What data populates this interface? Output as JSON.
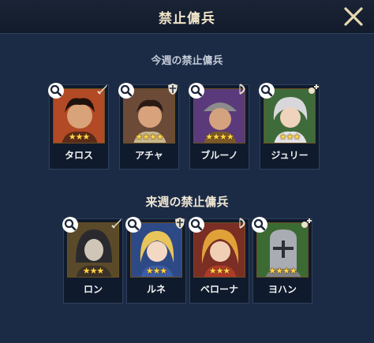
{
  "header": {
    "title": "禁止傭兵"
  },
  "this_week": {
    "title": "今週の禁止傭兵",
    "mercs": [
      {
        "name": "タロス",
        "stars": "★★★",
        "role_icon": "sword-icon",
        "bg": "#b34a26"
      },
      {
        "name": "アチャ",
        "stars": "★★★★",
        "role_icon": "shield-icon",
        "bg": "#6b4a38"
      },
      {
        "name": "ブルーノ",
        "stars": "★★★★",
        "role_icon": "bow-icon",
        "bg": "#5a3a7a"
      },
      {
        "name": "ジュリー",
        "stars": "★★★",
        "role_icon": "support-icon",
        "bg": "#3f6b3a"
      }
    ]
  },
  "next_week": {
    "title": "来週の禁止傭兵",
    "mercs": [
      {
        "name": "ロン",
        "stars": "★★★",
        "role_icon": "sword-icon",
        "bg": "#5a4a2a"
      },
      {
        "name": "ルネ",
        "stars": "★★★",
        "role_icon": "shield-icon",
        "bg": "#2e4a86"
      },
      {
        "name": "ベローナ",
        "stars": "★★★",
        "role_icon": "bow-icon",
        "bg": "#7a2e24"
      },
      {
        "name": "ヨハン",
        "stars": "★★★★",
        "role_icon": "support-icon",
        "bg": "#3c6a33"
      }
    ]
  },
  "colors": {
    "accent_gold": "#ffd54a",
    "panel": "#1c2b45"
  }
}
